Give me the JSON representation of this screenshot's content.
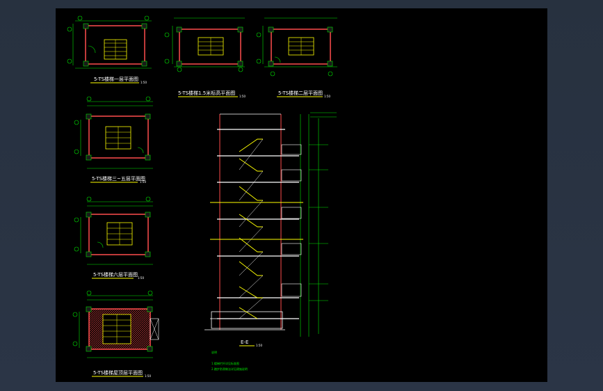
{
  "app": {
    "view_label": "",
    "colors": {
      "background": "#28323f",
      "paper": "#000000",
      "wall": "#ff4d4d",
      "line_green": "#00e600",
      "accent_yellow": "#ffff00",
      "white": "#ffffff",
      "cyan": "#00ffff"
    }
  },
  "sheets": {
    "plan_1": {
      "title": "5-TS楼梯一层平面图",
      "scale": "1:50"
    },
    "plan_2": {
      "title": "5-TS楼梯1.5米标高平面图",
      "scale": "1:50"
    },
    "plan_3": {
      "title": "5-TS楼梯二层平面图",
      "scale": "1:50"
    },
    "plan_4": {
      "title": "5-TS楼梯三~五层平面图",
      "scale": "1:50"
    },
    "plan_5": {
      "title": "5-TS楼梯六层平面图",
      "scale": "1:50"
    },
    "plan_6": {
      "title": "5-TS楼梯屋顶层平面图",
      "scale": "1:50"
    },
    "section": {
      "title": "E-E",
      "scale": "1:50"
    }
  },
  "notes": {
    "heading": "说明",
    "line_1": "1.楼梯栏杆详见标准图",
    "line_2": "2.踏步防滑做法详见建施说明"
  }
}
